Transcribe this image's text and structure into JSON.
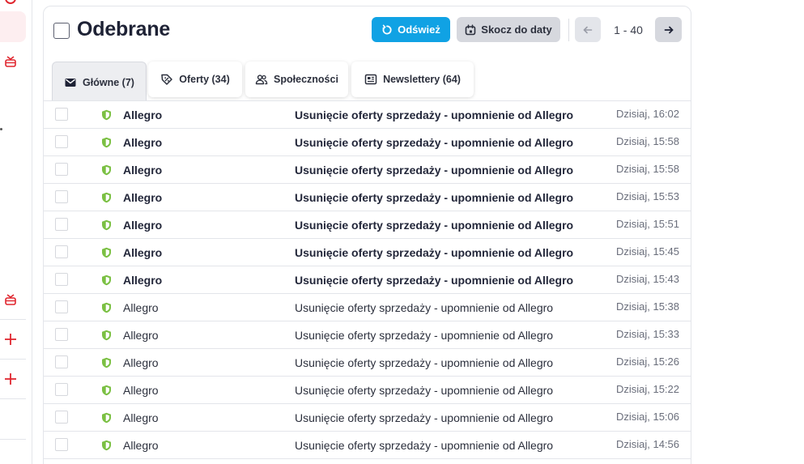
{
  "mailbox": {
    "title": "Odebrane"
  },
  "toolbar": {
    "refresh_label": "Odśwież",
    "jump_label": "Skocz do daty",
    "page_range": "1 - 40"
  },
  "tabs": [
    {
      "label": "Główne (7)",
      "icon": "envelope-icon",
      "active": true
    },
    {
      "label": "Oferty (34)",
      "icon": "tag-icon",
      "active": false
    },
    {
      "label": "Społeczności",
      "icon": "people-icon",
      "active": false
    },
    {
      "label": "Newslettery (64)",
      "icon": "newspaper-icon",
      "active": false
    }
  ],
  "colors": {
    "accent": "#10a2e4",
    "brand_red": "#e0262f",
    "shield_green": "#7bc043"
  },
  "messages": [
    {
      "sender": "Allegro",
      "subject": "Usunięcie oferty sprzedaży - upomnienie od Allegro",
      "time": "Dzisiaj, 16:02",
      "unread": true
    },
    {
      "sender": "Allegro",
      "subject": "Usunięcie oferty sprzedaży - upomnienie od Allegro",
      "time": "Dzisiaj, 15:58",
      "unread": true
    },
    {
      "sender": "Allegro",
      "subject": "Usunięcie oferty sprzedaży - upomnienie od Allegro",
      "time": "Dzisiaj, 15:58",
      "unread": true
    },
    {
      "sender": "Allegro",
      "subject": "Usunięcie oferty sprzedaży - upomnienie od Allegro",
      "time": "Dzisiaj, 15:53",
      "unread": true
    },
    {
      "sender": "Allegro",
      "subject": "Usunięcie oferty sprzedaży - upomnienie od Allegro",
      "time": "Dzisiaj, 15:51",
      "unread": true
    },
    {
      "sender": "Allegro",
      "subject": "Usunięcie oferty sprzedaży - upomnienie od Allegro",
      "time": "Dzisiaj, 15:45",
      "unread": true
    },
    {
      "sender": "Allegro",
      "subject": "Usunięcie oferty sprzedaży - upomnienie od Allegro",
      "time": "Dzisiaj, 15:43",
      "unread": true
    },
    {
      "sender": "Allegro",
      "subject": "Usunięcie oferty sprzedaży - upomnienie od Allegro",
      "time": "Dzisiaj, 15:38",
      "unread": false
    },
    {
      "sender": "Allegro",
      "subject": "Usunięcie oferty sprzedaży - upomnienie od Allegro",
      "time": "Dzisiaj, 15:33",
      "unread": false
    },
    {
      "sender": "Allegro",
      "subject": "Usunięcie oferty sprzedaży - upomnienie od Allegro",
      "time": "Dzisiaj, 15:26",
      "unread": false
    },
    {
      "sender": "Allegro",
      "subject": "Usunięcie oferty sprzedaży - upomnienie od Allegro",
      "time": "Dzisiaj, 15:22",
      "unread": false
    },
    {
      "sender": "Allegro",
      "subject": "Usunięcie oferty sprzedaży - upomnienie od Allegro",
      "time": "Dzisiaj, 15:06",
      "unread": false
    },
    {
      "sender": "Allegro",
      "subject": "Usunięcie oferty sprzedaży - upomnienie od Allegro",
      "time": "Dzisiaj, 14:56",
      "unread": false
    }
  ]
}
